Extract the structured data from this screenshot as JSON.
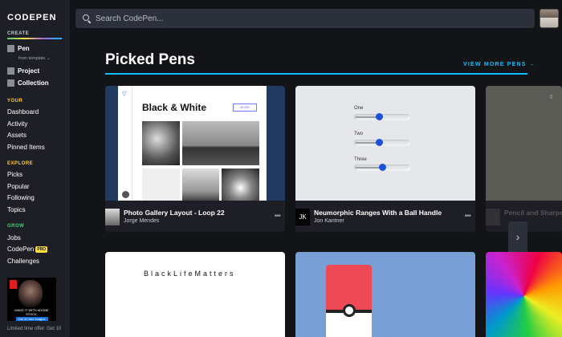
{
  "brand": "CODEPEN",
  "sidebar": {
    "create_label": "CREATE",
    "pen": "Pen",
    "from_template": "from template",
    "project": "Project",
    "collection": "Collection",
    "your_label": "YOUR",
    "your_items": [
      "Dashboard",
      "Activity",
      "Assets",
      "Pinned Items"
    ],
    "explore_label": "EXPLORE",
    "explore_items": [
      "Picks",
      "Popular",
      "Following",
      "Topics"
    ],
    "grow_label": "GROW",
    "jobs": "Jobs",
    "codepen_pro": "CodePen",
    "pro_badge": "PRO",
    "challenges": "Challenges",
    "ad_text": "MAKE IT WITH ADOBE STOCK.",
    "ad_button": "Get 10 free images",
    "limited": "Limited time offer: Get 10"
  },
  "search": {
    "placeholder": "Search CodePen..."
  },
  "main": {
    "title": "Picked Pens",
    "view_more": "VIEW MORE PENS"
  },
  "cards": [
    {
      "title": "Photo Gallery Layout - Loop 22",
      "author": "Jorge Mendes",
      "heading": "Black & White",
      "button": "MORE"
    },
    {
      "title": "Neumorphic Ranges With a Ball Handle",
      "author": "Jon Kantner",
      "avatar_text": "JK",
      "sliders": [
        {
          "label": "One",
          "value": 0.45
        },
        {
          "label": "Two",
          "value": 0.45
        },
        {
          "label": "Three",
          "value": 0.5
        }
      ]
    },
    {
      "title": "Pencil and Sharpene"
    }
  ],
  "row2": [
    {
      "text": "BlackLifeMatters"
    }
  ],
  "colors": {
    "accent": "#0ebeff",
    "bg": "#131417",
    "sidebar": "#1e1f26"
  }
}
